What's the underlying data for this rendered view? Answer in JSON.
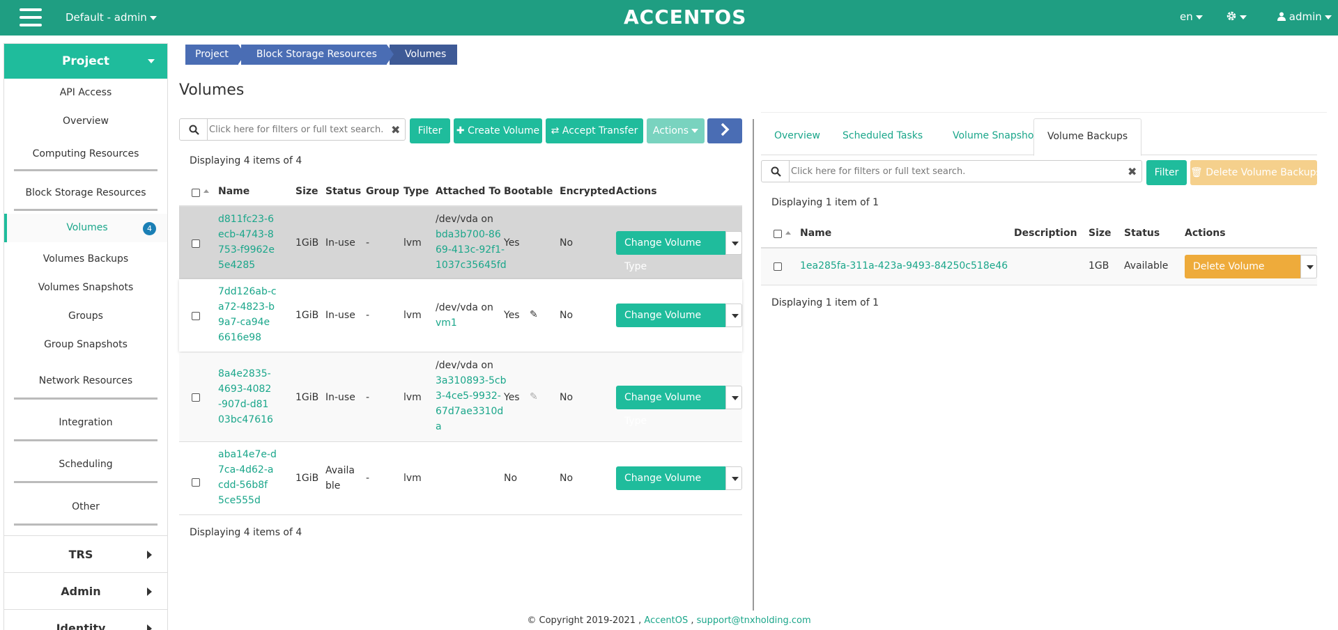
{
  "header": {
    "project_selector": "Default - admin",
    "logo": "ACCENTOS",
    "language": "en",
    "user": "admin",
    "icons": [
      "menu-icon",
      "gear-icon",
      "user-icon"
    ]
  },
  "sidebar": {
    "project": "Project",
    "items": {
      "api_access": "API Access",
      "overview": "Overview",
      "computing": "Computing Resources",
      "block_storage": "Block Storage Resources",
      "volumes": "Volumes",
      "volumes_count": "4",
      "volumes_backups": "Volumes Backups",
      "volumes_snapshots": "Volumes Snapshots",
      "groups": "Groups",
      "group_snapshots": "Group Snapshots",
      "network": "Network Resources",
      "integration": "Integration",
      "scheduling": "Scheduling",
      "other": "Other"
    },
    "sections": {
      "trs": "TRS",
      "admin": "Admin",
      "identity": "Identity"
    }
  },
  "breadcrumb": [
    "Project",
    "Block Storage Resources",
    "Volumes"
  ],
  "page_title": "Volumes",
  "left": {
    "search_placeholder": "Click here for filters or full text search.",
    "filter": "Filter",
    "create_volume": "Create Volume",
    "accept_transfer": "Accept Transfer",
    "actions": "Actions",
    "displaying": "Displaying 4 items of 4",
    "columns": [
      "Name",
      "Size",
      "Status",
      "Group",
      "Type",
      "Attached To",
      "Bootable",
      "Encrypted",
      "Actions"
    ],
    "rows": [
      {
        "name": [
          "d811fc23-6",
          "ecb-4743-8",
          "753-f9962e",
          "5e4285"
        ],
        "size": "1GiB",
        "status": [
          "In-use"
        ],
        "group": "-",
        "type": "lvm",
        "attached_prefix": "/dev/vda on",
        "attached_link": [
          "bda3b700-86",
          "69-413c-92f1-",
          "1037c35645fd"
        ],
        "bootable": "Yes",
        "encrypted": "No",
        "action": "Change Volume Type"
      },
      {
        "name": [
          "7dd126ab-c",
          "a72-4823-b",
          "9a7-ca94e",
          "6616e98"
        ],
        "size": "1GiB",
        "status": [
          "In-use"
        ],
        "group": "-",
        "type": "lvm",
        "attached_prefix": "/dev/vda on",
        "attached_link": [
          "vm1"
        ],
        "bootable": "Yes",
        "encrypted": "No",
        "action": "Change Volume Type"
      },
      {
        "name": [
          "8a4e2835-",
          "4693-4082",
          "-907d-d81",
          "03bc47616"
        ],
        "size": "1GiB",
        "status": [
          "In-use"
        ],
        "group": "-",
        "type": "lvm",
        "attached_prefix": "/dev/vda on",
        "attached_link": [
          "3a310893-5cb",
          "3-4ce5-9932-",
          "67d7ae3310d",
          "a"
        ],
        "bootable": "Yes",
        "encrypted": "No",
        "action": "Change Volume Type"
      },
      {
        "name": [
          "aba14e7e-d",
          "7ca-4d62-a",
          "cdd-56b8f",
          "5ce555d"
        ],
        "size": "1GiB",
        "status": [
          "Availa",
          "ble"
        ],
        "group": "-",
        "type": "lvm",
        "attached_prefix": "",
        "attached_link": [],
        "bootable": "No",
        "encrypted": "No",
        "action": "Change Volume Type"
      }
    ],
    "footer": "Displaying 4 items of 4"
  },
  "right": {
    "tabs": [
      "Overview",
      "Scheduled Tasks",
      "Volume Snapshots",
      "Volume Backups"
    ],
    "search_placeholder": "Click here for filters or full text search.",
    "filter": "Filter",
    "delete_backups": "Delete Volume Backups",
    "displaying": "Displaying 1 item of 1",
    "columns": [
      "Name",
      "Description",
      "Size",
      "Status",
      "Actions"
    ],
    "rows": [
      {
        "name": "1ea285fa-311a-423a-9493-84250c518e46",
        "description": "",
        "size": "1GB",
        "status": "Available",
        "action": "Delete Volume Backup"
      }
    ],
    "footer": "Displaying 1 item of 1"
  },
  "footer": {
    "copyright": "© Copyright 2019-2021 ,",
    "brand": "AccentOS",
    "sep": ",",
    "email": "support@tnxholding.com"
  },
  "colors": {
    "header": "#1f9e82",
    "accent": "#1fbc9c",
    "breadcrumb": "#4a6db4",
    "warning": "#eeab3b"
  }
}
